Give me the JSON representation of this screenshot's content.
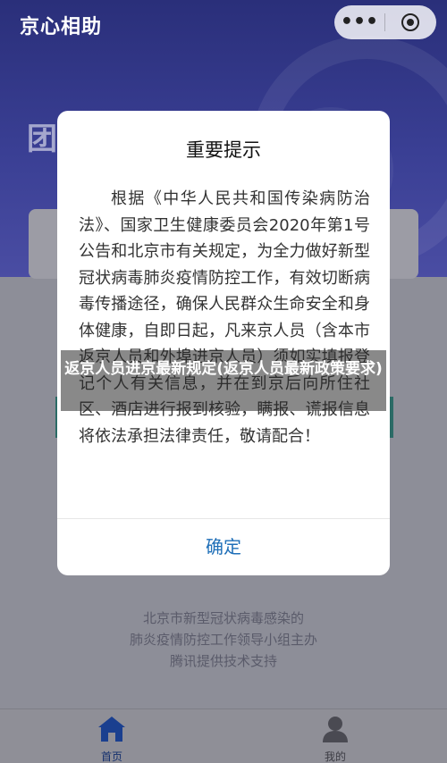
{
  "app": {
    "title": "京心相助",
    "hero_big_text": "团",
    "capsule_menu": "•••"
  },
  "footer": {
    "line1": "北京市新型冠状病毒感染的",
    "line2": "肺炎疫情防控工作领导小组主办",
    "line3": "腾讯提供技术支持"
  },
  "tabbar": {
    "home_label": "首页",
    "mine_label": "我的",
    "home_color": "#1a3f8f"
  },
  "modal": {
    "title": "重要提示",
    "body": "根据《中华人民共和国传染病防治法》、国家卫生健康委员会2020年第1号公告和北京市有关规定，为全力做好新型冠状病毒肺炎疫情防控工作，有效切断病毒传播途径，确保人民群众生命安全和身体健康，自即日起，凡来京人员（含本市返京人员和外埠进京人员）须如实填报登记个人有关信息，并在到京后向所住社区、酒店进行报到核验，瞒报、谎报信息将依法承担法律责任，敬请配合！",
    "confirm_label": "确定",
    "confirm_color": "#1f6fb8"
  },
  "banner": {
    "text": "返京人员进京最新规定(返京人员最新政策要求)"
  }
}
